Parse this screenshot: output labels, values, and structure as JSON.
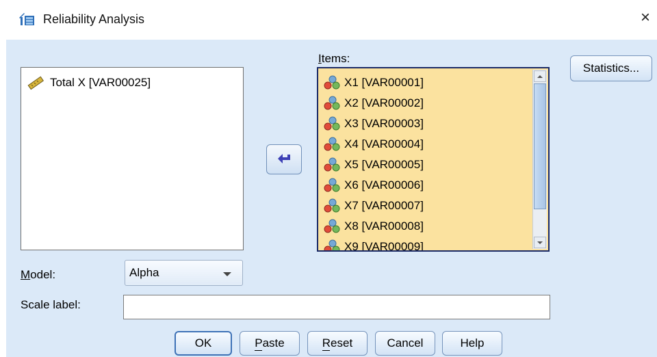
{
  "window": {
    "title": "Reliability Analysis",
    "close_glyph": "×"
  },
  "source_list": {
    "items": [
      {
        "label": "Total X [VAR00025]",
        "icon": "scale-ruler-icon"
      }
    ]
  },
  "move_button": {
    "icon": "arrow-left-icon"
  },
  "items_list": {
    "label": "Items:",
    "items": [
      "X1 [VAR00001]",
      "X2 [VAR00002]",
      "X3 [VAR00003]",
      "X4 [VAR00004]",
      "X5 [VAR00005]",
      "X6 [VAR00006]",
      "X7 [VAR00007]",
      "X8 [VAR00008]",
      "X9 [VAR00009]"
    ],
    "item_icon": "nominal-variable-icon"
  },
  "buttons": {
    "statistics": "Statistics...",
    "ok": "OK",
    "paste": "Paste",
    "reset": "Reset",
    "cancel": "Cancel",
    "help": "Help"
  },
  "model": {
    "label": "Model:",
    "value": "Alpha"
  },
  "scale_label": {
    "label": "Scale label:",
    "value": ""
  },
  "colors": {
    "dialog_bg": "#dbe9f8",
    "items_bg": "#fbe29f",
    "items_border": "#1a2a66"
  }
}
